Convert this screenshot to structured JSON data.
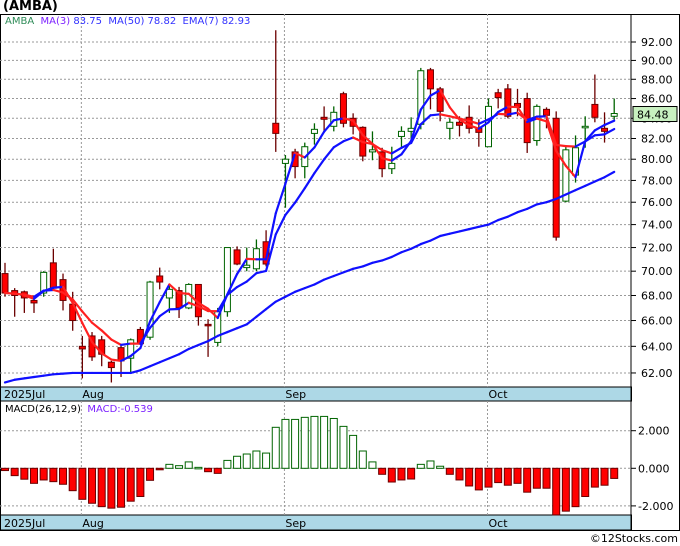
{
  "title": "(AMBA)",
  "legend": {
    "symbol": "AMBA",
    "ma3_label": "MA(3)",
    "ma3_value": "83.75",
    "ma50_label": "MA(50)",
    "ma50_value": "78.82",
    "ema7_label": "EMA(7)",
    "ema7_value": "82.93"
  },
  "macd_legend": {
    "label": "MACD(26,12,9)",
    "value": "MACD:-0.539"
  },
  "last_price_label": "84.48",
  "credit": "©12Stocks.com",
  "colors": {
    "up": "#006400",
    "down": "#ff0000",
    "down_wick": "#6b0000",
    "ma": "#1010ff",
    "ema": "#ff2020",
    "date_band": "#add8e6",
    "last_price_bg": "#c8f0c0"
  },
  "chart_data": [
    {
      "type": "candlestick",
      "title": "",
      "y_scale": "log",
      "ylim": [
        61,
        94
      ],
      "y_ticks": [
        "62.00",
        "64.00",
        "66.00",
        "68.00",
        "70.00",
        "72.00",
        "74.00",
        "76.00",
        "78.00",
        "80.00",
        "82.00",
        "84.00",
        "86.00",
        "88.00",
        "90.00",
        "92.00"
      ],
      "x_ticks": [
        {
          "label": "2025Jul",
          "index": 0
        },
        {
          "label": "Aug",
          "index": 8
        },
        {
          "label": "Sep",
          "index": 29
        },
        {
          "label": "Oct",
          "index": 50
        }
      ],
      "grid": true,
      "ohlc": [
        [
          69.8,
          70.7,
          67.9,
          68.2
        ],
        [
          68.4,
          68.6,
          66.3,
          68.0
        ],
        [
          68.3,
          68.4,
          66.6,
          67.8
        ],
        [
          67.6,
          68.0,
          66.6,
          67.4
        ],
        [
          68.2,
          70.0,
          67.9,
          69.9
        ],
        [
          70.7,
          71.9,
          68.5,
          68.6
        ],
        [
          69.3,
          69.8,
          66.8,
          67.6
        ],
        [
          67.3,
          68.3,
          65.2,
          66.0
        ],
        [
          64.0,
          64.8,
          61.6,
          63.8
        ],
        [
          64.8,
          65.1,
          62.9,
          63.2
        ],
        [
          64.5,
          64.8,
          62.5,
          63.4
        ],
        [
          62.8,
          62.9,
          61.3,
          62.4
        ],
        [
          63.9,
          64.0,
          61.7,
          62.9
        ],
        [
          63.1,
          64.6,
          62.0,
          64.5
        ],
        [
          65.3,
          65.5,
          64.1,
          64.2
        ],
        [
          64.7,
          69.2,
          64.5,
          69.1
        ],
        [
          69.6,
          70.3,
          68.5,
          69.1
        ],
        [
          67.8,
          68.9,
          66.6,
          68.5
        ],
        [
          68.4,
          68.7,
          66.2,
          67.0
        ],
        [
          67.0,
          69.0,
          66.9,
          68.9
        ],
        [
          68.9,
          68.9,
          65.6,
          66.3
        ],
        [
          65.7,
          66.1,
          63.2,
          65.6
        ],
        [
          64.3,
          67.0,
          64.0,
          66.7
        ],
        [
          66.7,
          72.0,
          66.3,
          72.0
        ],
        [
          71.8,
          72.1,
          70.5,
          70.6
        ],
        [
          70.3,
          72.0,
          70.0,
          70.5
        ],
        [
          70.2,
          72.7,
          70.0,
          71.9
        ],
        [
          72.5,
          73.5,
          70.4,
          70.6
        ],
        [
          83.5,
          93.3,
          80.7,
          82.5
        ],
        [
          79.6,
          80.4,
          75.5,
          80.0
        ],
        [
          80.7,
          81.0,
          78.2,
          79.3
        ],
        [
          79.3,
          81.6,
          78.2,
          81.2
        ],
        [
          82.5,
          83.5,
          81.4,
          82.9
        ],
        [
          84.1,
          85.2,
          82.7,
          83.9
        ],
        [
          83.2,
          85.2,
          82.7,
          84.6
        ],
        [
          86.5,
          86.7,
          83.1,
          83.5
        ],
        [
          84.0,
          84.5,
          82.4,
          83.2
        ],
        [
          83.1,
          83.2,
          79.8,
          80.3
        ],
        [
          80.7,
          82.7,
          79.9,
          80.9
        ],
        [
          80.7,
          81.1,
          78.3,
          79.1
        ],
        [
          79.1,
          81.2,
          78.6,
          79.6
        ],
        [
          82.2,
          83.2,
          81.1,
          82.7
        ],
        [
          82.7,
          84.1,
          81.9,
          83.0
        ],
        [
          83.4,
          89.2,
          82.9,
          88.9
        ],
        [
          89.0,
          89.2,
          84.9,
          87.0
        ],
        [
          87.0,
          87.2,
          83.7,
          84.7
        ],
        [
          83.0,
          84.0,
          81.9,
          83.6
        ],
        [
          83.6,
          84.2,
          82.2,
          83.3
        ],
        [
          84.1,
          85.3,
          82.5,
          83.0
        ],
        [
          83.0,
          83.9,
          81.2,
          82.6
        ],
        [
          81.2,
          86.0,
          81.2,
          85.2
        ],
        [
          86.6,
          87.0,
          85.0,
          86.1
        ],
        [
          87.0,
          87.5,
          84.0,
          84.2
        ],
        [
          85.5,
          87.0,
          84.2,
          85.1
        ],
        [
          86.0,
          86.6,
          80.6,
          81.6
        ],
        [
          81.8,
          85.4,
          81.3,
          85.2
        ],
        [
          84.9,
          85.1,
          83.0,
          84.3
        ],
        [
          84.0,
          84.7,
          72.6,
          72.9
        ],
        [
          76.1,
          81.3,
          76.0,
          80.9
        ],
        [
          78.5,
          82.3,
          77.8,
          81.1
        ],
        [
          83.1,
          84.2,
          81.1,
          83.2
        ],
        [
          85.4,
          88.5,
          83.6,
          84.1
        ],
        [
          83.0,
          84.6,
          81.6,
          82.7
        ],
        [
          84.2,
          86.0,
          83.7,
          84.48
        ]
      ],
      "ma50": [
        61.3,
        61.5,
        61.6,
        61.7,
        61.8,
        61.9,
        61.95,
        62.0,
        62.0,
        62.0,
        62.0,
        62.0,
        62.0,
        62.0,
        62.2,
        62.5,
        62.8,
        63.1,
        63.4,
        63.8,
        64.1,
        64.4,
        64.8,
        65.1,
        65.4,
        65.7,
        66.3,
        66.9,
        67.5,
        67.9,
        68.3,
        68.6,
        68.9,
        69.3,
        69.6,
        69.9,
        70.2,
        70.4,
        70.7,
        70.9,
        71.2,
        71.6,
        71.9,
        72.3,
        72.6,
        73.0,
        73.2,
        73.4,
        73.6,
        73.8,
        74.0,
        74.4,
        74.7,
        75.1,
        75.4,
        75.8,
        76.0,
        76.3,
        76.7,
        77.1,
        77.5,
        77.9,
        78.3,
        78.8
      ]
    },
    {
      "type": "bar",
      "title": "MACD(26,12,9)",
      "ylim": [
        -2.6,
        3.3
      ],
      "y_ticks": [
        "2.000",
        "0.000",
        "-2.000"
      ],
      "x_ticks": [
        {
          "label": "2025Jul",
          "index": 0
        },
        {
          "label": "Aug",
          "index": 8
        },
        {
          "label": "Sep",
          "index": 29
        },
        {
          "label": "Oct",
          "index": 50
        }
      ],
      "values": [
        -0.12,
        -0.39,
        -0.58,
        -0.8,
        -0.62,
        -0.71,
        -0.85,
        -1.19,
        -1.65,
        -1.86,
        -2.04,
        -2.12,
        -2.07,
        -1.75,
        -1.5,
        -0.64,
        -0.05,
        0.21,
        0.14,
        0.34,
        0.05,
        -0.18,
        -0.27,
        0.42,
        0.64,
        0.76,
        0.92,
        0.81,
        2.18,
        2.6,
        2.6,
        2.71,
        2.76,
        2.76,
        2.65,
        2.23,
        1.75,
        0.92,
        0.34,
        -0.32,
        -0.73,
        -0.62,
        -0.57,
        0.21,
        0.39,
        0.11,
        -0.32,
        -0.62,
        -0.94,
        -1.15,
        -1.0,
        -0.76,
        -0.9,
        -0.8,
        -1.27,
        -1.06,
        -1.06,
        -2.48,
        -2.28,
        -2.04,
        -1.5,
        -1.0,
        -0.9,
        -0.539
      ]
    }
  ]
}
